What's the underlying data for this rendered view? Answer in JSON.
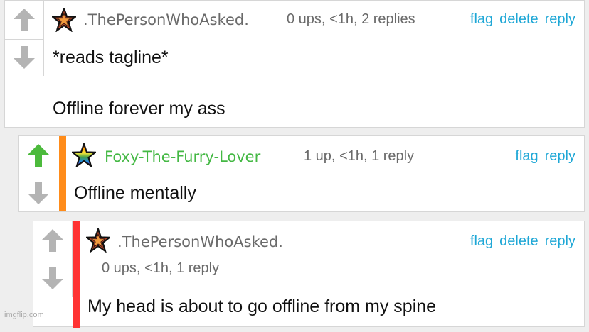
{
  "comments": [
    {
      "username": ".ThePersonWhoAsked.",
      "meta": "0 ups, <1h, 2 replies",
      "actions": [
        "flag",
        "delete",
        "reply"
      ],
      "body_lines": [
        "*reads tagline*",
        "Offline forever my ass"
      ],
      "upvote_active": false
    },
    {
      "username": "Foxy-The-Furry-Lover",
      "meta": "1 up, <1h, 1 reply",
      "actions": [
        "flag",
        "reply"
      ],
      "body_lines": [
        "Offline mentally"
      ],
      "upvote_active": true,
      "stripe_color": "#ff8c1a"
    },
    {
      "username": ".ThePersonWhoAsked.",
      "meta": "0 ups, <1h, 1 reply",
      "actions": [
        "flag",
        "delete",
        "reply"
      ],
      "body_lines": [
        "My head is about to go offline from my spine"
      ],
      "upvote_active": false,
      "stripe_color": "#ff3333"
    }
  ],
  "watermark": "imgflip.com",
  "colors": {
    "link": "#1ea7d6",
    "vote_inactive": "#b4b4b4",
    "vote_active": "#4cba3c",
    "username_green": "#44b844"
  },
  "icons": {
    "upvote": "arrow-up-icon",
    "downvote": "arrow-down-icon",
    "avatar_1": "star-avatar-icon",
    "avatar_2": "rainbow-star-avatar-icon"
  }
}
